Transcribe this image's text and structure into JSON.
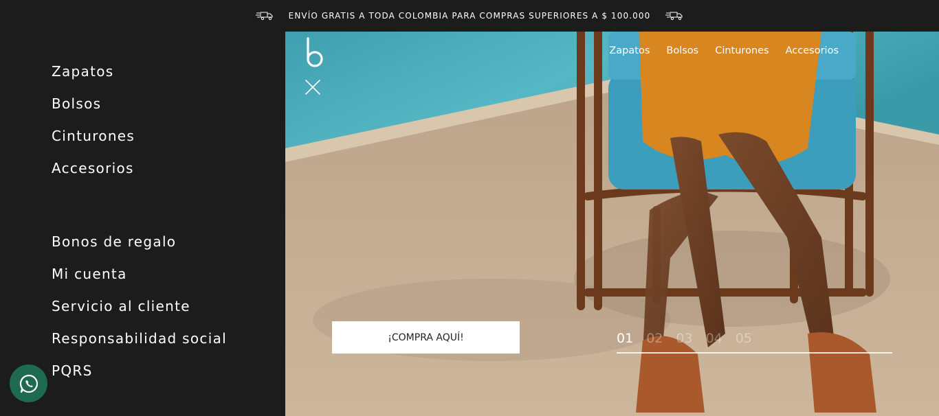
{
  "announcement": {
    "text": "ENVÍO GRATIS A TODA COLOMBIA PARA COMPRAS SUPERIORES A $ 100.000",
    "left_icon": "truck-icon",
    "right_icon": "truck-icon"
  },
  "sidebar": {
    "primary": [
      {
        "label": "Zapatos"
      },
      {
        "label": "Bolsos"
      },
      {
        "label": "Cinturones"
      },
      {
        "label": "Accesorios"
      }
    ],
    "secondary": [
      {
        "label": "Bonos de regalo"
      },
      {
        "label": "Mi cuenta"
      },
      {
        "label": "Servicio al cliente"
      },
      {
        "label": "Responsabilidad social"
      },
      {
        "label": "PQRS"
      }
    ]
  },
  "header": {
    "logo_icon": "b-logo-icon",
    "close_icon": "close-icon",
    "nav": [
      {
        "label": "Zapatos"
      },
      {
        "label": "Bolsos"
      },
      {
        "label": "Cinturones"
      },
      {
        "label": "Accesorios"
      }
    ]
  },
  "hero": {
    "cta_label": "¡COMPRA AQUÍ!",
    "slides": [
      "01",
      "02",
      "03",
      "04",
      "05"
    ],
    "active_slide": "01"
  },
  "whatsapp": {
    "icon": "whatsapp-icon"
  },
  "colors": {
    "background": "#1c1c1c",
    "whatsapp": "#1e6b52",
    "text": "#ffffff"
  }
}
